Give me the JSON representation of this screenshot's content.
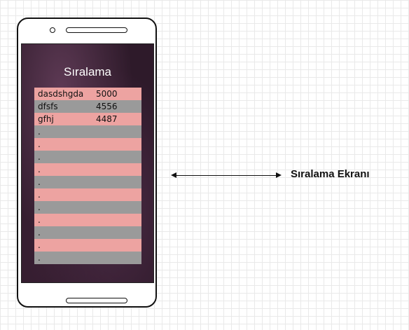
{
  "screen": {
    "title": "Sıralama"
  },
  "rows": [
    {
      "name": "dasdshgda",
      "score": "5000"
    },
    {
      "name": "dfsfs",
      "score": "4556"
    },
    {
      "name": "gfhj",
      "score": "4487"
    },
    {
      "name": ".",
      "score": ""
    },
    {
      "name": ".",
      "score": ""
    },
    {
      "name": ".",
      "score": ""
    },
    {
      "name": ".",
      "score": ""
    },
    {
      "name": ".",
      "score": ""
    },
    {
      "name": ".",
      "score": ""
    },
    {
      "name": ".",
      "score": ""
    },
    {
      "name": ".",
      "score": ""
    },
    {
      "name": ".",
      "score": ""
    },
    {
      "name": ".",
      "score": ""
    },
    {
      "name": ".",
      "score": ""
    }
  ],
  "annotation": {
    "label": "Sıralama Ekranı"
  },
  "colors": {
    "row_pink": "#eda3a1",
    "row_gray": "#9a9a9a"
  }
}
